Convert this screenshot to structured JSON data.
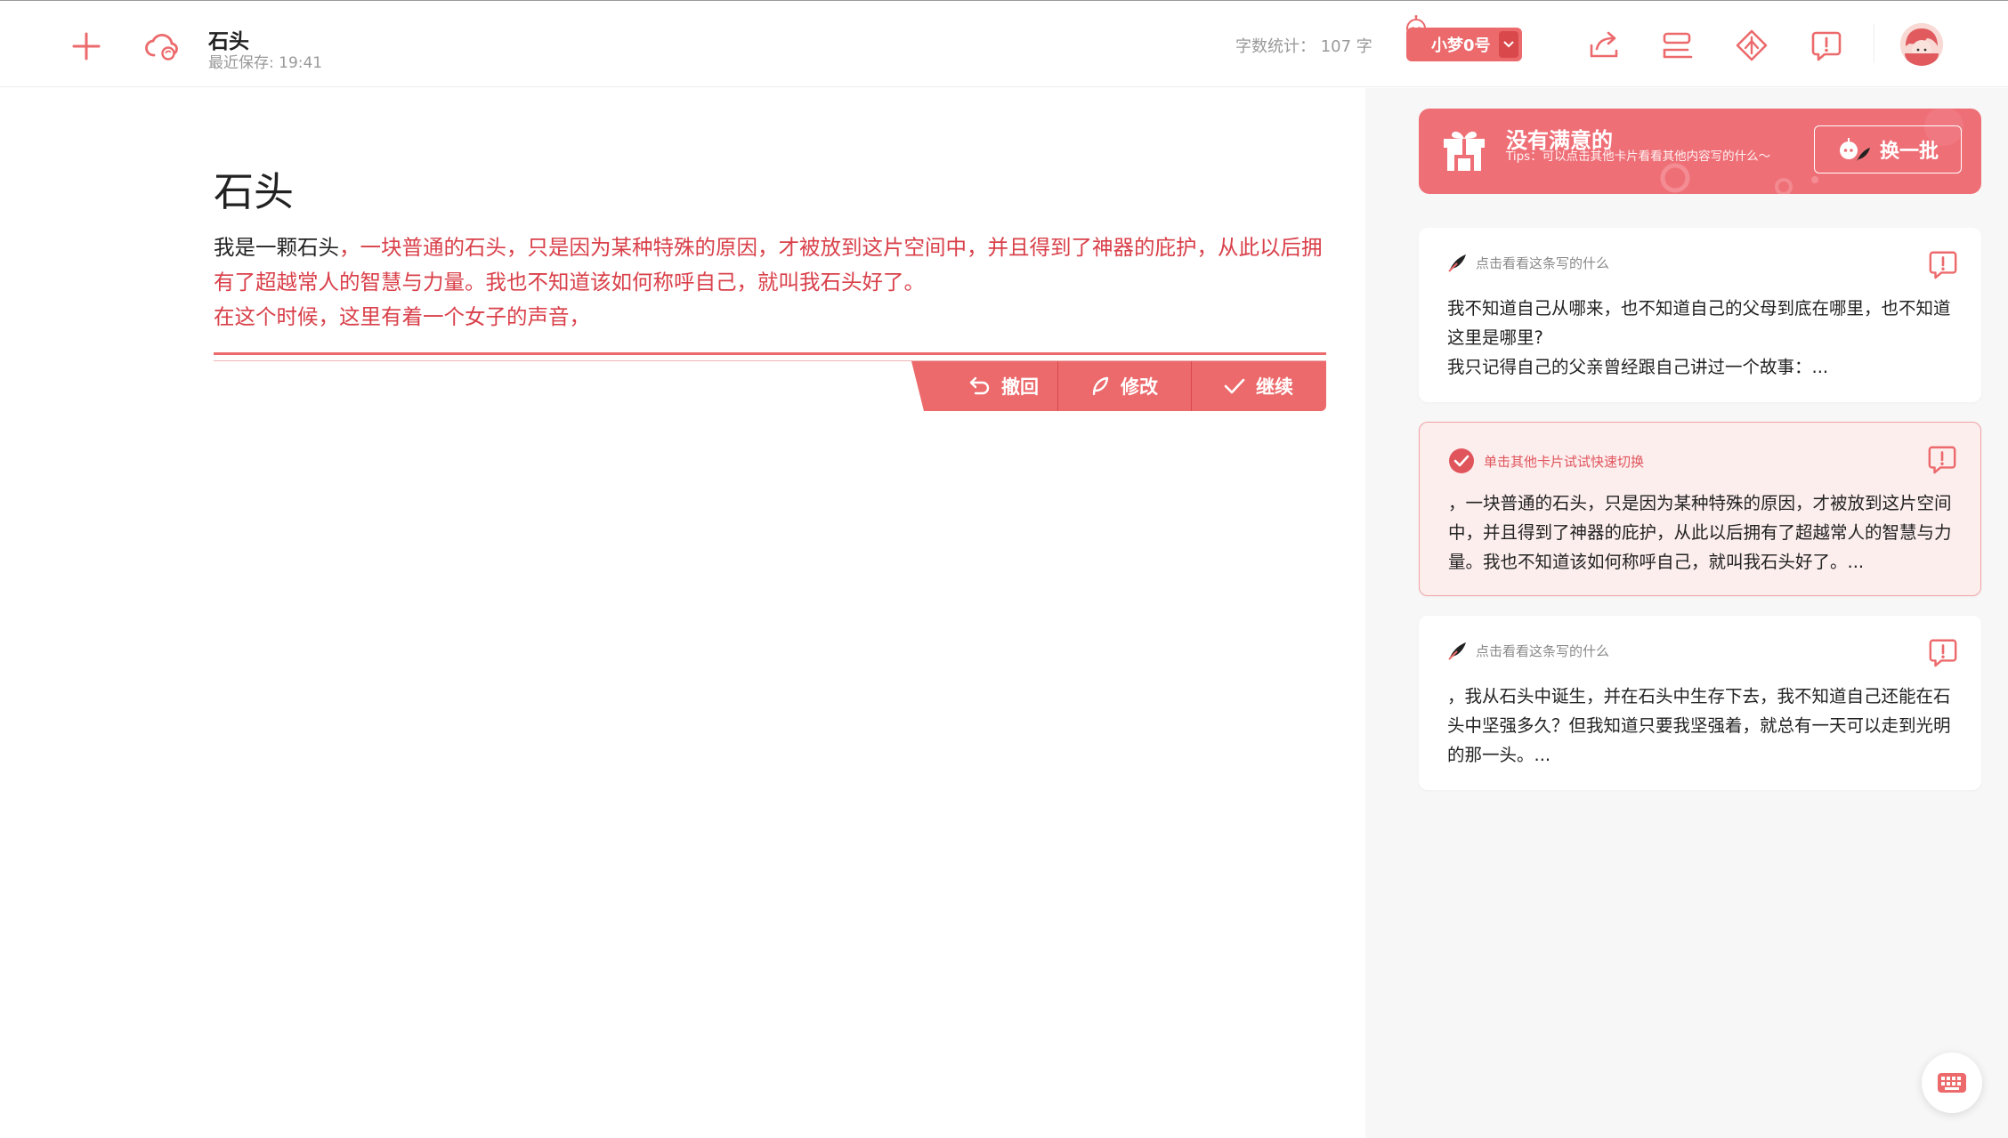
{
  "header": {
    "doc_title": "石头",
    "last_save": "最近保存: 19:41",
    "word_count": "字数统计： 107 字",
    "model_label": "小梦0号"
  },
  "editor": {
    "title": "石头",
    "body_user": "我是一颗石头",
    "body_generated_1": "，一块普通的石头，只是因为某种特殊的原因，才被放到这片空间中，并且得到了神器的庇护，从此以后拥有了超越常人的智慧与力量。我也不知道该如何称呼自己，就叫我石头好了。",
    "body_generated_2": "在这个时候，这里有着一个女子的声音，",
    "actions": {
      "undo_label": "撤回",
      "edit_label": "修改",
      "continue_label": "继续"
    }
  },
  "side": {
    "banner": {
      "title": "没有满意的",
      "tips": "Tips：可以点击其他卡片看看其他内容写的什么～",
      "refresh_label": "换一批"
    },
    "cards": [
      {
        "hint": "点击看看这条写的什么",
        "text_line1": "我不知道自己从哪来，也不知道自己的父母到底在哪里，也不知道这里是哪里?",
        "text_line2": "我只记得自己的父亲曾经跟自己讲过一个故事：...",
        "selected": false
      },
      {
        "hint": "单击其他卡片试试快速切换",
        "text_line1": "，一块普通的石头，只是因为某种特殊的原因，才被放到这片空间中，并且得到了神器的庇护，从此以后拥有了超越常人的智慧与力量。我也不知道该如何称呼自己，就叫我石头好了。...",
        "selected": true
      },
      {
        "hint": "点击看看这条写的什么",
        "text_line1": "，我从石头中诞生，并在石头中生存下去，我不知道自己还能在石头中坚强多久？但我知道只要我坚强着，就总有一天可以走到光明的那一头。...",
        "selected": false
      }
    ]
  },
  "colors": {
    "accent": "#ec6a6c",
    "accent_dark": "#d9494c",
    "generated_text": "#d9404a",
    "selected_card_bg": "#fdeeee"
  },
  "icons": [
    "plus-icon",
    "cloud-sync-icon",
    "share-icon",
    "outline-icon",
    "compass-icon",
    "feedback-icon",
    "avatar",
    "robot-icon",
    "undo-icon",
    "pen-icon",
    "check-icon",
    "keyboard-icon"
  ]
}
